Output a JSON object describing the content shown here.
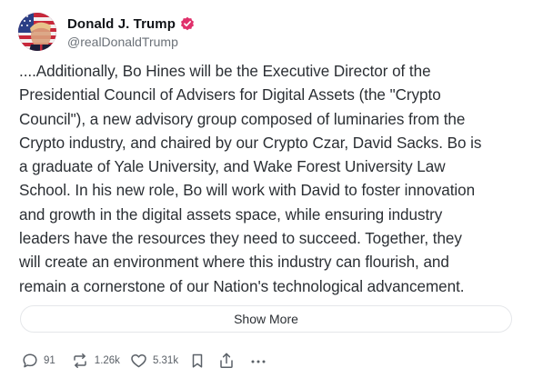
{
  "author": {
    "display_name": "Donald J. Trump",
    "handle": "@realDonaldTrump",
    "verified": true
  },
  "post": {
    "text": "....Additionally, Bo Hines will be the Executive Director of the\nPresidential Council of Advisers for Digital Assets (the \"Crypto\nCouncil\"), a new advisory group composed of luminaries from the\nCrypto industry, and chaired by our Crypto Czar, David Sacks. Bo is\na graduate of Yale University, and Wake Forest University Law\nSchool. In his new role, Bo will work with David to foster innovation\nand growth in the digital assets space, while ensuring industry\nleaders have the resources they need to succeed. Together, they\nwill create an environment where this industry can flourish, and\nremain a cornerstone of our Nation's technological advancement.",
    "show_more_label": "Show More"
  },
  "actions": {
    "replies": "91",
    "reposts": "1.26k",
    "likes": "5.31k"
  },
  "icons": {
    "reply": "comment-bubble-icon",
    "repost": "repost-arrows-icon",
    "like": "heart-icon",
    "bookmark": "bookmark-icon",
    "share": "share-upload-icon",
    "more": "more-dots-icon",
    "verified": "verified-badge-icon"
  },
  "colors": {
    "verified_badge": "#e0306b",
    "icon_gray": "#5b6168",
    "avatar_red": "#c8283a",
    "avatar_blue": "#2b3f86"
  }
}
